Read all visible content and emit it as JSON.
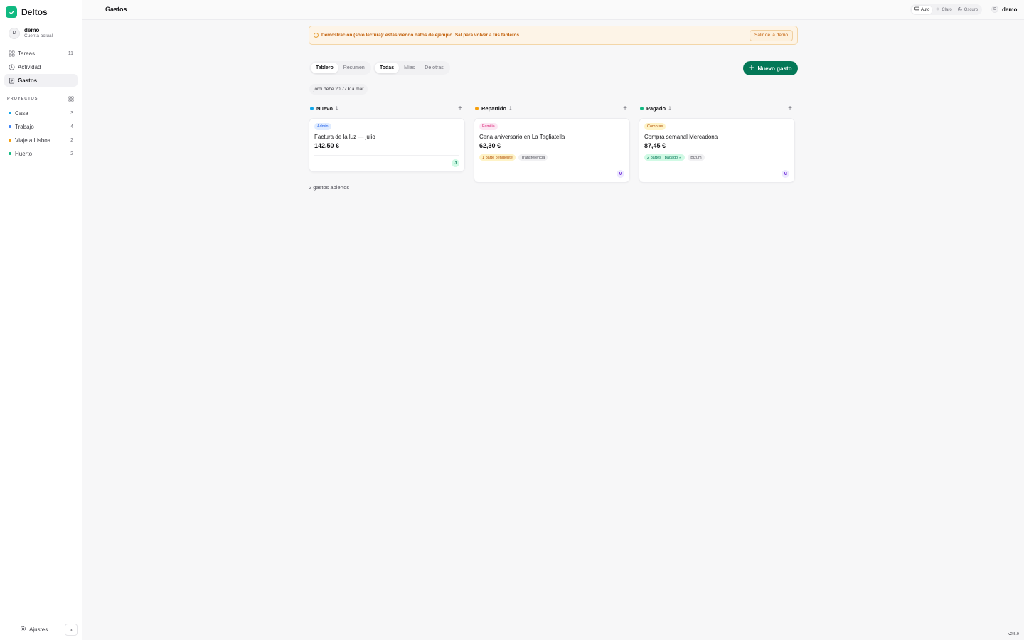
{
  "app": {
    "name": "Deltos",
    "version": "v2.5.9"
  },
  "account": {
    "initial": "D",
    "name": "demo",
    "subtitle": "Cuenta actual"
  },
  "nav": [
    {
      "label": "Tareas",
      "count": "11",
      "icon": "grid-icon"
    },
    {
      "label": "Actividad",
      "count": "",
      "icon": "clock-icon"
    },
    {
      "label": "Gastos",
      "count": "",
      "icon": "receipt-icon",
      "active": true
    }
  ],
  "projects": {
    "title": "PROYECTOS",
    "items": [
      {
        "label": "Casa",
        "count": "3",
        "color": "#0ea5e9"
      },
      {
        "label": "Trabajo",
        "count": "4",
        "color": "#3b82f6"
      },
      {
        "label": "Viaje a Lisboa",
        "count": "2",
        "color": "#f59e0b"
      },
      {
        "label": "Huerto",
        "count": "2",
        "color": "#10b981"
      }
    ]
  },
  "footer": {
    "settings_label": "Ajustes",
    "collapse_icon": "«"
  },
  "header": {
    "title": "Gastos",
    "theme": {
      "auto": "Auto",
      "light": "Claro",
      "dark": "Oscuro"
    },
    "user": {
      "initial": "D",
      "name": "demo"
    }
  },
  "banner": {
    "text": "Demostración (solo lectura): estás viendo datos de ejemplo. Sal para volver a tus tableros.",
    "button": "Salir de la demo"
  },
  "view_tabs": [
    "Tablero",
    "Resumen"
  ],
  "filter_tabs": [
    "Todas",
    "Mías",
    "De otras"
  ],
  "new_button": "Nuevo gasto",
  "balance": "jordi debe 20,77 € a mar",
  "columns": [
    {
      "title": "Nuevo",
      "count": "1",
      "color": "#0ea5e9",
      "card": {
        "tag": "Admin",
        "tag_bg": "#e0ecff",
        "tag_fg": "#2563eb",
        "title": "Factura de la luz — julio",
        "amount": "142,50 €",
        "pills": [],
        "avatar": "J",
        "avatar_bg": "#d1fae5",
        "avatar_fg": "#047857",
        "paid": false
      }
    },
    {
      "title": "Repartido",
      "count": "1",
      "color": "#f59e0b",
      "card": {
        "tag": "Familia",
        "tag_bg": "#fce7f3",
        "tag_fg": "#db2777",
        "title": "Cena aniversario en La Tagliatella",
        "amount": "62,30 €",
        "pills": [
          {
            "label": "1 parte pendiente",
            "bg": "#fef3c7",
            "fg": "#b45309"
          },
          {
            "label": "Transferencia",
            "bg": "#f1f1f3",
            "fg": "#52525b"
          }
        ],
        "avatar": "M",
        "avatar_bg": "#ede9fe",
        "avatar_fg": "#6d28d9",
        "paid": false
      }
    },
    {
      "title": "Pagado",
      "count": "1",
      "color": "#10b981",
      "card": {
        "tag": "Compras",
        "tag_bg": "#fef3c7",
        "tag_fg": "#b45309",
        "title": "Compra semanal Mercadona",
        "amount": "87,45 €",
        "pills": [
          {
            "label": "2 partes · pagado ✓",
            "bg": "#d1fae5",
            "fg": "#047857"
          },
          {
            "label": "Bizum",
            "bg": "#f1f1f3",
            "fg": "#52525b"
          }
        ],
        "avatar": "M",
        "avatar_bg": "#ede9fe",
        "avatar_fg": "#6d28d9",
        "paid": true
      }
    }
  ],
  "open_count": "2 gastos abiertos"
}
